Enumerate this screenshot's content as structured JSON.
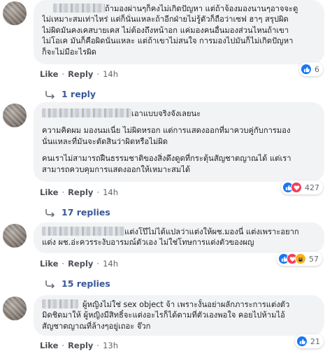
{
  "comments": [
    {
      "lines": [
        "ถ้ามองผ่านๆก็คงไม่เกิดปัญหา แต่ถ้าจ้องมองนานๆอาจจะดู",
        "ไม่เหมาะสมเท่าไหร่ แต่ก็นั่นแหละถ้าอีกฝ่ายไม่รู้ตัวก็ถือว่าเซฟ ฮาๆ สรุปผิด",
        "ไม่ผิดมันคงเคสบายเคส ไม่ต้องถึงหน้าอก แค่มองคนอื่นมองส่วนไหนถ้าเขา",
        "ไม่โอเค มันก็คือผิดนั่นแหละ แต่ถ้าเขาไม่สนใจ การมองไปมันก็ไม่เกิดปัญหา",
        "ก็จะไม่มีอะไรผิด"
      ],
      "like_label": "Like",
      "reply_label": "Reply",
      "time": "14h",
      "reaction_count": "6",
      "replies_label": "1 reply"
    },
    {
      "paragraphs": [
        [
          "เอาแบบจริงจังเลยนะ"
        ],
        [
          "ความคิดผม มองนมเนี่ย ไม่ผิดหรอก แต่การแสดงออกที่มาควบคู่กับการมอง",
          "นั่นแหละที่มันจะตัดสินว่าผิดหรือไม่ผิด"
        ],
        [
          "คนเราไม่สามารถฝืนธรรมชาติของสิ่งดึงดูดที่กระตุ้นสัญชาตญาณได้ แต่เรา",
          "สามารถควบคุมการแสดงออกให้เหมาะสมได้"
        ]
      ],
      "like_label": "Like",
      "reply_label": "Reply",
      "time": "14h",
      "reaction_count": "427",
      "replies_label": "17 replies"
    },
    {
      "lines": [
        "แต่งโป๊ไม่ได้แปลว่าแต่งให้ผช.มองนี่ แต่งเพราะอยาก",
        "แต่ง ผช.อ่ะควรระงับอารมณ์ตัวเอง ไม่ใช่โทษการแต่งตัวของผญ"
      ],
      "like_label": "Like",
      "reply_label": "Reply",
      "time": "14h",
      "reaction_count": "57",
      "replies_label": "15 replies"
    },
    {
      "lines": [
        "ผู้หญิงไม่ใช่ sex object จ้า เพราะงั้นอย่าผลักภาระการแต่งตัว",
        "มิดชิดมาให้ ผู้หญิงมีสิทธิ์จะแต่งอะไรก็ได้ตามที่ตัวเองพอใจ คอยไปห้ามไอ้",
        "สัญชาตญาณที่ล้างๆอยู่เถอะ จ๊วก"
      ],
      "like_label": "Like",
      "reply_label": "Reply",
      "time": "13h",
      "reaction_count": "21"
    }
  ],
  "colors": {
    "bubble": "#f2f3f5",
    "link": "#385898",
    "like_blue": "#1877f2",
    "love_red": "#f33e58",
    "haha_yellow": "#f7b125"
  },
  "icons": [
    "like-reaction-icon",
    "love-reaction-icon",
    "haha-reaction-icon",
    "reply-arrow-icon"
  ]
}
